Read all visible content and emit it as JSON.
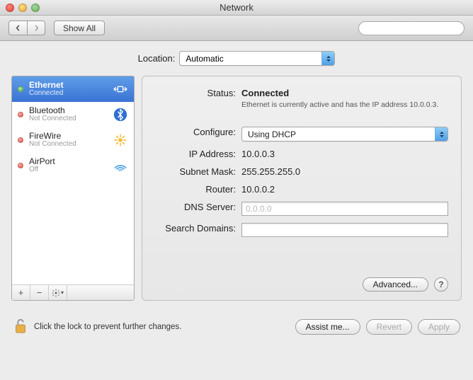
{
  "window": {
    "title": "Network"
  },
  "toolbar": {
    "show_all": "Show All",
    "search_placeholder": ""
  },
  "location": {
    "label": "Location:",
    "value": "Automatic"
  },
  "sidebar": {
    "items": [
      {
        "name": "Ethernet",
        "status": "Connected",
        "dot": "green",
        "icon": "ethernet",
        "selected": true
      },
      {
        "name": "Bluetooth",
        "status": "Not Connected",
        "dot": "red",
        "icon": "bluetooth",
        "selected": false
      },
      {
        "name": "FireWire",
        "status": "Not Connected",
        "dot": "red",
        "icon": "firewire",
        "selected": false
      },
      {
        "name": "AirPort",
        "status": "Off",
        "dot": "red",
        "icon": "airport",
        "selected": false
      }
    ]
  },
  "details": {
    "status_label": "Status:",
    "status_value": "Connected",
    "status_desc": "Ethernet is currently active and has the IP address 10.0.0.3.",
    "configure_label": "Configure:",
    "configure_value": "Using DHCP",
    "ip_label": "IP Address:",
    "ip_value": "10.0.0.3",
    "subnet_label": "Subnet Mask:",
    "subnet_value": "255.255.255.0",
    "router_label": "Router:",
    "router_value": "10.0.0.2",
    "dns_label": "DNS Server:",
    "dns_value": "",
    "dns_placeholder": "0.0.0.0",
    "search_label": "Search Domains:",
    "search_value": "",
    "advanced": "Advanced..."
  },
  "footer": {
    "lock_text": "Click the lock to prevent further changes.",
    "assist": "Assist me...",
    "revert": "Revert",
    "apply": "Apply"
  }
}
